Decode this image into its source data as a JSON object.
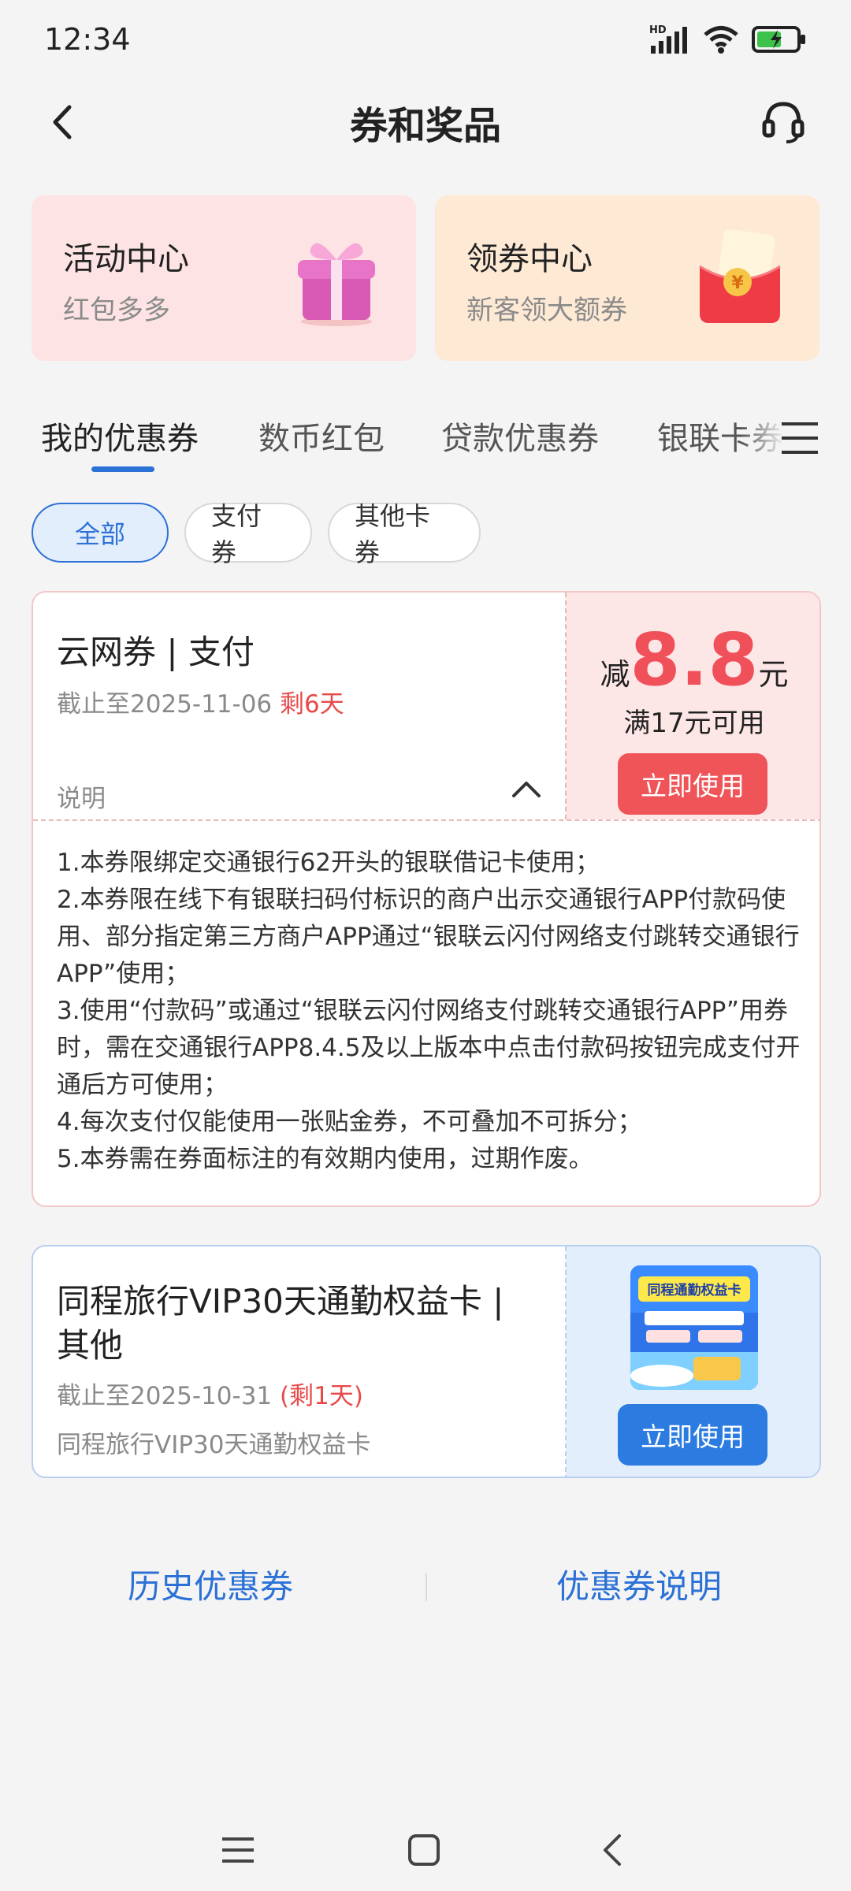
{
  "status": {
    "time": "12:34",
    "hd": "HD"
  },
  "header": {
    "title": "券和奖品"
  },
  "cards": [
    {
      "title": "活动中心",
      "subtitle": "红包多多",
      "icon": "gift-icon"
    },
    {
      "title": "领券中心",
      "subtitle": "新客领大额券",
      "icon": "red-envelope-icon"
    }
  ],
  "tabs": [
    "我的优惠券",
    "数币红包",
    "贷款优惠券",
    "银联卡券"
  ],
  "chips": [
    "全部",
    "支付券",
    "其他卡券"
  ],
  "coupon1": {
    "name": "云网券 | 支付",
    "expiry": "截止至2025-11-06",
    "remain": "剩6天",
    "note_label": "说明",
    "amount_prefix": "减",
    "amount": "8.8",
    "amount_unit": "元",
    "condition": "满17元可用",
    "button": "立即使用",
    "rules": [
      "1.本券限绑定交通银行62开头的银联借记卡使用；",
      "2.本券限在线下有银联扫码付标识的商户出示交通银行APP付款码使用、部分指定第三方商户APP通过“银联云闪付网络支付跳转交通银行APP”使用；",
      "3.使用“付款码”或通过“银联云闪付网络支付跳转交通银行APP”用券时，需在交通银行APP8.4.5及以上版本中点击付款码按钮完成支付开通后方可使用；",
      "4.每次支付仅能使用一张贴金券，不可叠加不可拆分；",
      "5.本券需在券面标注的有效期内使用，过期作废。"
    ]
  },
  "coupon2": {
    "name": "同程旅行VIP30天通勤权益卡 | 其他",
    "expiry": "截止至2025-10-31",
    "remain": "(剩1天)",
    "desc": "同程旅行VIP30天通勤权益卡",
    "thumb_title": "同程通勤权益卡",
    "button": "立即使用"
  },
  "footer": {
    "history": "历史优惠券",
    "explain": "优惠券说明"
  },
  "colors": {
    "accent_blue": "#2c71d6",
    "accent_red": "#ef5458",
    "pink_bg": "#fde3e3",
    "peach_bg": "#fde9d4"
  }
}
